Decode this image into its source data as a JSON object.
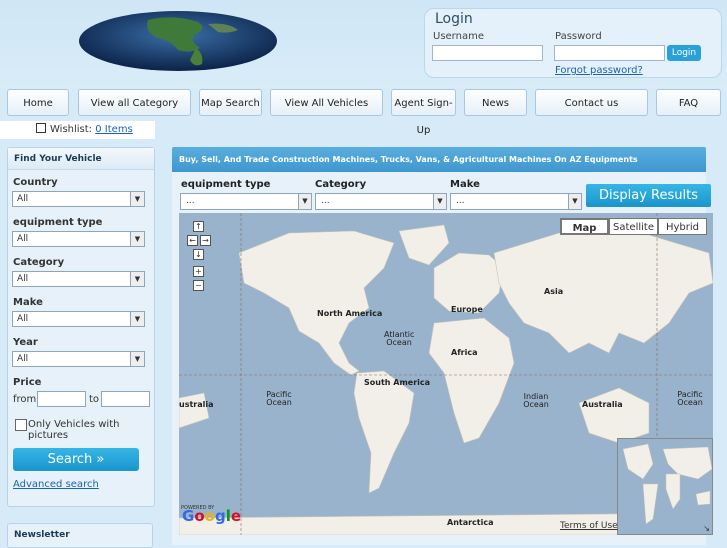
{
  "login": {
    "title": "Login",
    "username_label": "Username",
    "password_label": "Password",
    "button": "Login",
    "forgot": "Forgot password?"
  },
  "nav": [
    "Home",
    "View all Category",
    "Map Search",
    "View All Vehicles",
    "Agent Sign-Up",
    "News",
    "Contact us",
    "FAQ"
  ],
  "wishlist": {
    "label": "Wishlist:",
    "link": "0 Items"
  },
  "finder": {
    "title": "Find Your Vehicle",
    "country_label": "Country",
    "country_value": "All",
    "equipment_label": "equipment type",
    "equipment_value": "All",
    "category_label": "Category",
    "category_value": "All",
    "make_label": "Make",
    "make_value": "All",
    "year_label": "Year",
    "year_value": "All",
    "price_label": "Price",
    "from": "from",
    "to": "to",
    "pictures_label": "Only Vehicles with pictures",
    "search": "Search »",
    "advanced": "Advanced search"
  },
  "newsletter": "Newsletter",
  "banner": "Buy, Sell, And Trade Construction Machines, Trucks, Vans, & Agricultural Machines On AZ Equipments",
  "filters": {
    "equipment_label": "equipment type",
    "equipment_value": "...",
    "category_label": "Category",
    "category_value": "...",
    "make_label": "Make",
    "make_value": "...",
    "display": "Display Results"
  },
  "map": {
    "types": [
      "Map",
      "Satellite",
      "Hybrid"
    ],
    "labels": {
      "north_america": "North America",
      "south_america": "South America",
      "europe": "Europe",
      "asia": "Asia",
      "africa": "Africa",
      "australia": "Australia",
      "australia_left": "ustralia",
      "antarctica": "Antarctica",
      "atlantic": "Atlantic Ocean",
      "pacific_left": "Pacific Ocean",
      "pacific_right": "Pacific Ocean",
      "indian": "Indian Ocean"
    },
    "powered": "POWERED BY",
    "google": "Google",
    "terms": "Terms of Use"
  },
  "colors": {
    "accent": "#2aa0d8",
    "water": "#99b3cc",
    "land": "#f2efe9",
    "banner": "#4da3d8"
  }
}
